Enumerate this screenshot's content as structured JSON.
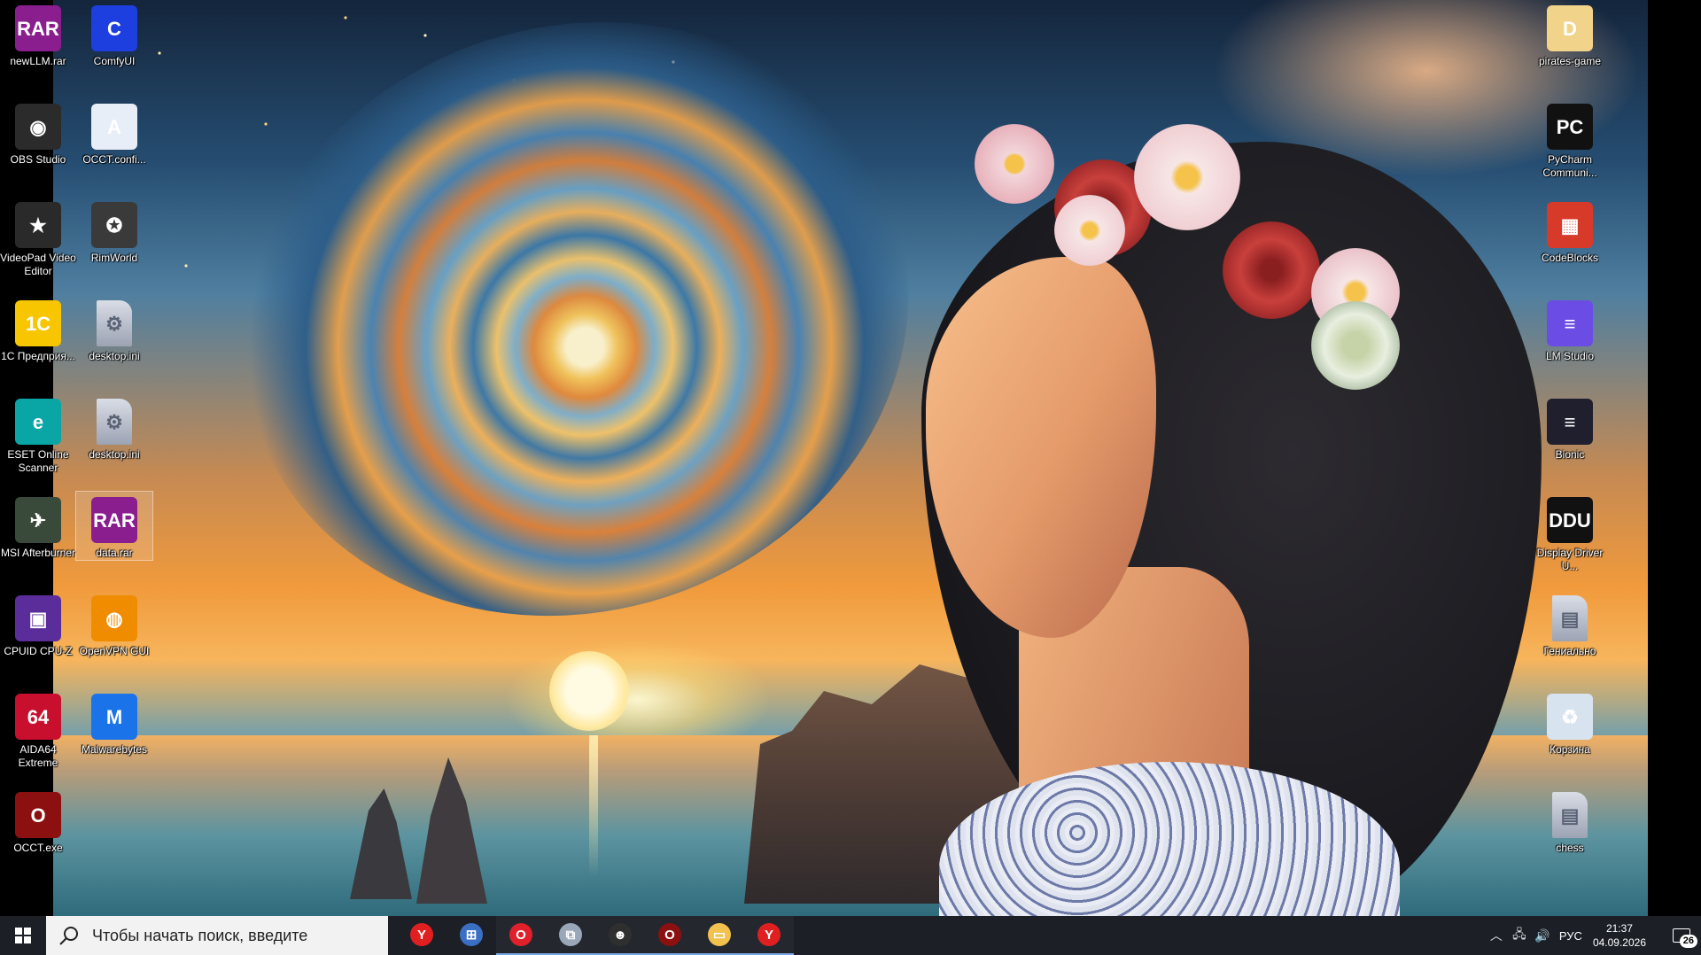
{
  "desktop": {
    "left_icons": [
      {
        "label": "newLLM.rar",
        "glyph": "RAR",
        "color": "#8b1e8e"
      },
      {
        "label": "ComfyUI",
        "glyph": "C",
        "color": "#1d3fe0"
      },
      {
        "label": "OBS Studio",
        "glyph": "◉",
        "color": "#2b2b2b"
      },
      {
        "label": "OCCT.confi...",
        "glyph": "A",
        "color": "#e8eef7"
      },
      {
        "label": "VideoPad Video Editor",
        "glyph": "★",
        "color": "#2a2a2a"
      },
      {
        "label": "RimWorld",
        "glyph": "✪",
        "color": "#3a3a3a"
      },
      {
        "label": "1С Предприя...",
        "glyph": "1С",
        "color": "#f7c600"
      },
      {
        "label": "desktop.ini",
        "glyph": "⚙",
        "color": "#c9cdd6"
      },
      {
        "label": "ESET Online Scanner",
        "glyph": "e",
        "color": "#0aa6a6"
      },
      {
        "label": "desktop.ini",
        "glyph": "⚙",
        "color": "#c9cdd6"
      },
      {
        "label": "MSI Afterburner",
        "glyph": "✈",
        "color": "#3a4a3a"
      },
      {
        "label": "data.rar",
        "glyph": "RAR",
        "color": "#8b1e8e"
      },
      {
        "label": "CPUID CPU-Z",
        "glyph": "▣",
        "color": "#5a2d9a"
      },
      {
        "label": "OpenVPN GUI",
        "glyph": "◍",
        "color": "#f08c00"
      },
      {
        "label": "AIDA64 Extreme",
        "glyph": "64",
        "color": "#c8102e"
      },
      {
        "label": "Malwarebytes",
        "glyph": "M",
        "color": "#1a73e8"
      },
      {
        "label": "OCCT.exe",
        "glyph": "O",
        "color": "#8c1010"
      }
    ],
    "right_icons": [
      {
        "label": "pirates-game",
        "glyph": "D",
        "color": "#f2d38a"
      },
      {
        "label": "PyCharm Communi...",
        "glyph": "PC",
        "color": "#111111"
      },
      {
        "label": "CodeBlocks",
        "glyph": "▦",
        "color": "#d83a2a"
      },
      {
        "label": "LM Studio",
        "glyph": "≡",
        "color": "#6b4de6"
      },
      {
        "label": "Bionic",
        "glyph": "≡",
        "color": "#1f1f2e"
      },
      {
        "label": "Display Driver U...",
        "glyph": "DDU",
        "color": "#111111"
      },
      {
        "label": "Гениально",
        "glyph": "▤",
        "color": "#e8c36a"
      },
      {
        "label": "Корзина",
        "glyph": "♻",
        "color": "#d7e3ef"
      },
      {
        "label": "chess",
        "glyph": "▤",
        "color": "#efe0a0"
      }
    ]
  },
  "taskbar": {
    "search_placeholder": "Чтобы начать поиск, введите",
    "pinned": [
      {
        "name": "yandex-browser",
        "glyph": "Y",
        "color": "#e02020",
        "active": false
      },
      {
        "name": "network-tool",
        "glyph": "⊞",
        "color": "#3a6fc4",
        "active": false
      },
      {
        "name": "opera",
        "glyph": "O",
        "color": "#e0202a",
        "active": true
      },
      {
        "name": "file-copy",
        "glyph": "⧉",
        "color": "#9aa7b8",
        "active": true
      },
      {
        "name": "chat-app",
        "glyph": "☻",
        "color": "#2f2f2f",
        "active": true
      },
      {
        "name": "occt",
        "glyph": "O",
        "color": "#8c1010",
        "active": true
      },
      {
        "name": "file-explorer",
        "glyph": "▭",
        "color": "#f2c14e",
        "active": true
      },
      {
        "name": "yandex",
        "glyph": "Y",
        "color": "#e02020",
        "active": true
      }
    ],
    "tray_lang": "РУС",
    "time": "21:37",
    "date": "04.09.2026",
    "notifications": "26"
  }
}
